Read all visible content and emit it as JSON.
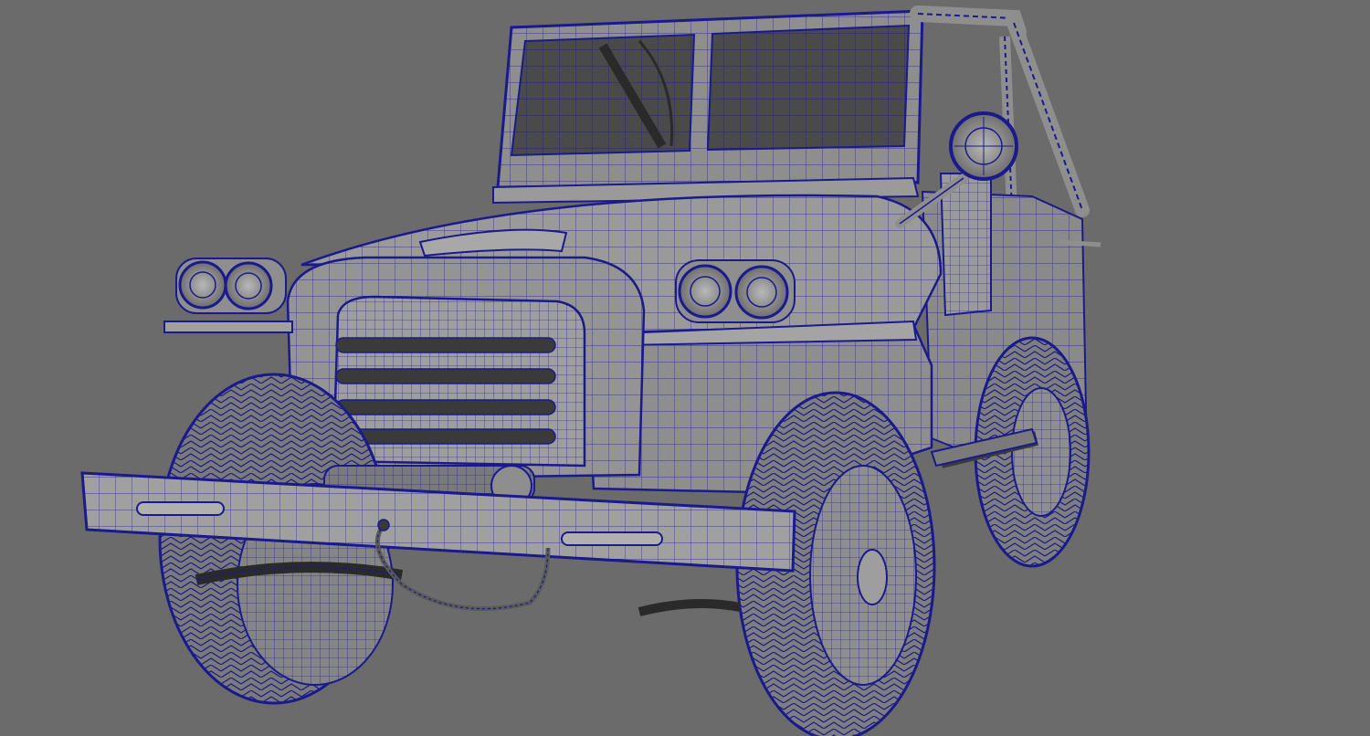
{
  "viewport": {
    "background": "#6b6b6b",
    "model_fill": "#8e8e8e",
    "model_fill_light": "#a4a4a4",
    "model_fill_dark": "#5a5a5a",
    "wire_color": "#1a1a8c",
    "glass_fill": "#4a4a4a"
  },
  "model": {
    "subject": "wireframe-jeep-icon",
    "display_mode": "wireframe-on-shaded"
  }
}
